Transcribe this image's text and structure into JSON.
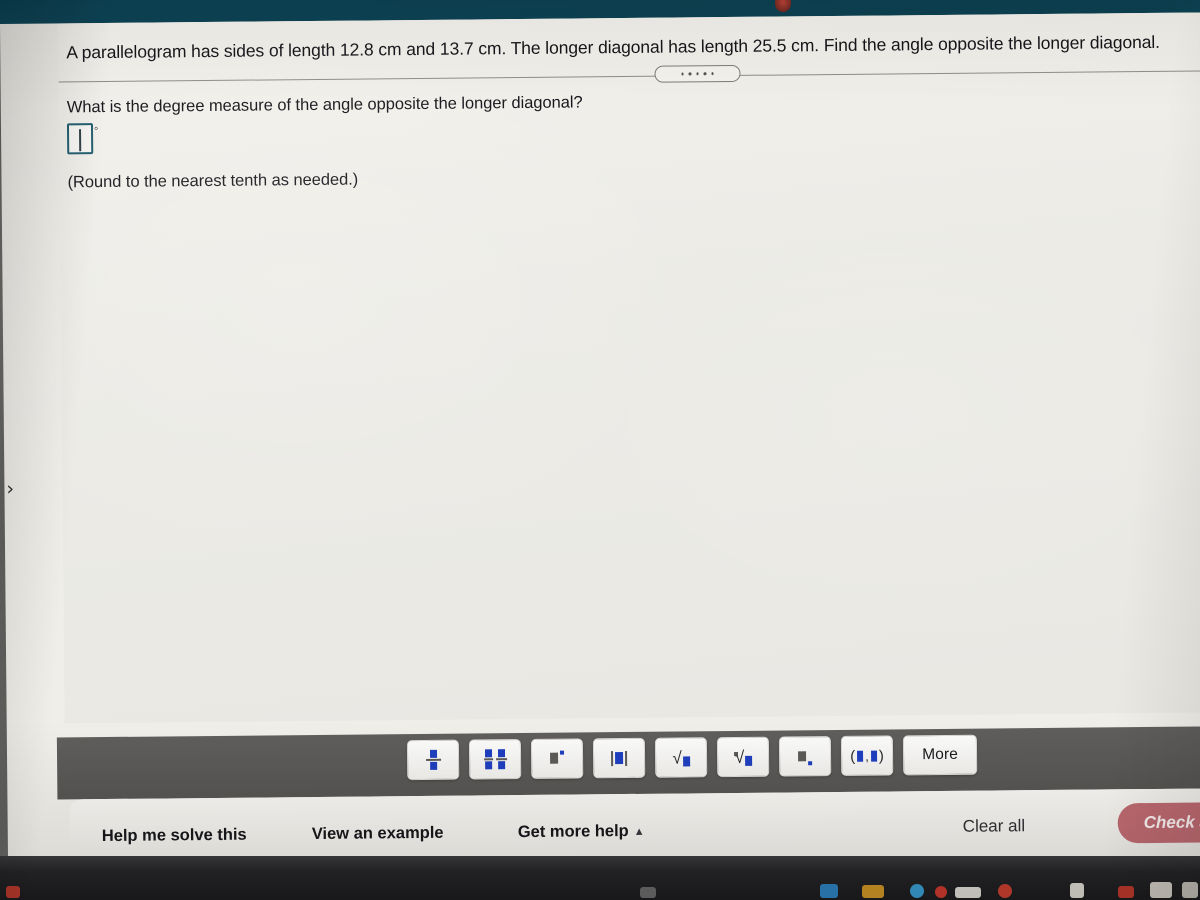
{
  "problem": {
    "statement": "A parallelogram has sides of length 12.8 cm and 13.7 cm. The longer diagonal has length 25.5 cm. Find the angle opposite the longer diagonal.",
    "question": "What is the degree measure of the angle opposite the longer diagonal?",
    "answer_value": "",
    "degree_symbol": "◦",
    "rounding_note": "(Round to the nearest tenth as needed.)"
  },
  "divider": {
    "handle_dots": [
      "·",
      "·",
      "·",
      "·",
      "·"
    ]
  },
  "math_palette": {
    "buttons": [
      {
        "name": "fraction",
        "label": ""
      },
      {
        "name": "mixed-number",
        "label": ""
      },
      {
        "name": "exponent",
        "label": ""
      },
      {
        "name": "absolute-value",
        "label": ""
      },
      {
        "name": "square-root",
        "label": ""
      },
      {
        "name": "nth-root",
        "label": ""
      },
      {
        "name": "subscript",
        "label": ""
      },
      {
        "name": "ordered-pair",
        "label": ""
      },
      {
        "name": "more",
        "label": "More"
      }
    ]
  },
  "actions": {
    "help_me_solve_this": "Help me solve this",
    "view_an_example": "View an example",
    "get_more_help": "Get more help",
    "get_more_help_caret": "▲",
    "clear_all": "Clear all",
    "check_answer": "Check answer"
  },
  "navigation": {
    "next_chevron": "›"
  },
  "colors": {
    "wall": "#0f4a5c",
    "page_background": "#efedE8",
    "input_border": "#1d5a6b",
    "palette_glyph_blue": "#1f3fbf",
    "palette_band": "#5f5e5c",
    "check_button": "#bf6b72",
    "text": "#16161a"
  }
}
